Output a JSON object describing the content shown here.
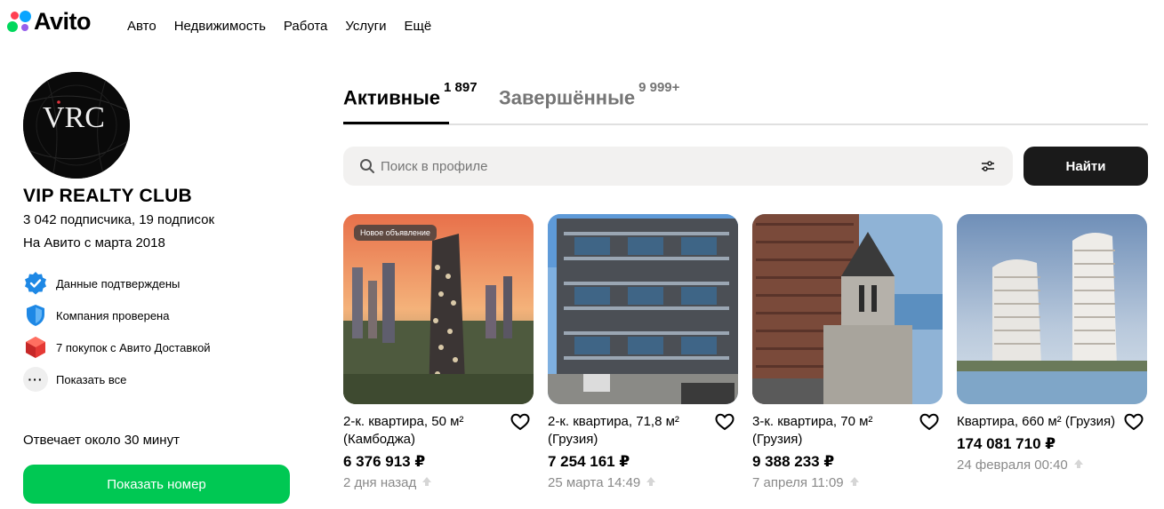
{
  "header": {
    "logo_text": "Avito",
    "nav": [
      "Авто",
      "Недвижимость",
      "Работа",
      "Услуги",
      "Ещё"
    ]
  },
  "profile": {
    "avatar_text": "VRC",
    "name": "VIP REALTY CLUB",
    "subscribers": "3 042 подписчика, 19 подписок",
    "since": "На Авито с марта 2018",
    "badges": [
      {
        "icon": "verified-check-icon",
        "text": "Данные подтверждены"
      },
      {
        "icon": "shield-icon",
        "text": "Компания проверена"
      },
      {
        "icon": "delivery-box-icon",
        "text": "7 покупок с Авито Доставкой"
      },
      {
        "icon": "more-dots-icon",
        "text": "Показать все"
      }
    ],
    "reply_time": "Отвечает около 30 минут",
    "show_phone": "Показать номер"
  },
  "tabs": [
    {
      "label": "Активные",
      "count": "1 897"
    },
    {
      "label": "Завершённые",
      "count": "9 999+"
    }
  ],
  "search": {
    "placeholder": "Поиск в профиле",
    "button": "Найти"
  },
  "listings": [
    {
      "badge": "Новое объявление",
      "title": "2-к. квартира, 50 м² (Камбоджа)",
      "price": "6 376 913 ₽",
      "date": "2 дня назад"
    },
    {
      "badge": "",
      "title": "2-к. квартира, 71,8 м² (Грузия)",
      "price": "7 254 161 ₽",
      "date": "25 марта 14:49"
    },
    {
      "badge": "",
      "title": "3-к. квартира, 70 м² (Грузия)",
      "price": "9 388 233 ₽",
      "date": "7 апреля 11:09"
    },
    {
      "badge": "",
      "title": "Квартира, 660 м² (Грузия)",
      "price": "174 081 710 ₽",
      "date": "24 февраля 00:40"
    }
  ],
  "colors": {
    "primary_green": "#00c853",
    "dark_button": "#1a1a1a",
    "search_bg": "#f2f1f0"
  }
}
